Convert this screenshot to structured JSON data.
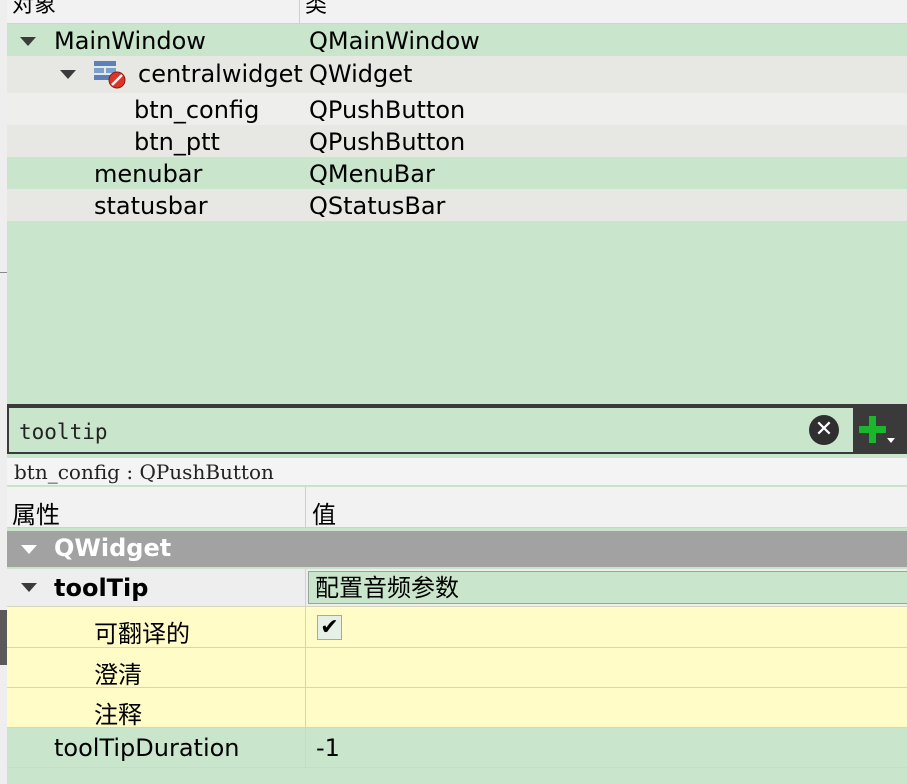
{
  "object_inspector": {
    "header": {
      "col_object": "对象",
      "col_class": "类"
    },
    "rows": [
      {
        "name": "MainWindow",
        "class": "QMainWindow"
      },
      {
        "name": "centralwidget",
        "class": "QWidget"
      },
      {
        "name": "btn_config",
        "class": "QPushButton"
      },
      {
        "name": "btn_ptt",
        "class": "QPushButton"
      },
      {
        "name": "menubar",
        "class": "QMenuBar"
      },
      {
        "name": "statusbar",
        "class": "QStatusBar"
      }
    ]
  },
  "filter": {
    "value": "tooltip"
  },
  "current_object": "btn_config : QPushButton",
  "property_editor": {
    "header": {
      "col_property": "属性",
      "col_value": "值"
    },
    "group": "QWidget",
    "tooltip": {
      "name": "toolTip",
      "value": "配置音频参数"
    },
    "subprops": [
      {
        "name": "可翻译的",
        "checked": "✔"
      },
      {
        "name": "澄清"
      },
      {
        "name": "注释"
      }
    ],
    "duration": {
      "name": "toolTipDuration",
      "value": "-1"
    }
  },
  "colors": {
    "selection_bg": "#c9e6cc",
    "group_bg": "#a2a2a2",
    "subprop_bg": "#fffcc8",
    "add_icon": "#19b82b"
  },
  "icons": [
    "expand-arrow-icon",
    "widget-broken-layout-icon",
    "clear-icon",
    "add-dynamic-property-icon"
  ]
}
